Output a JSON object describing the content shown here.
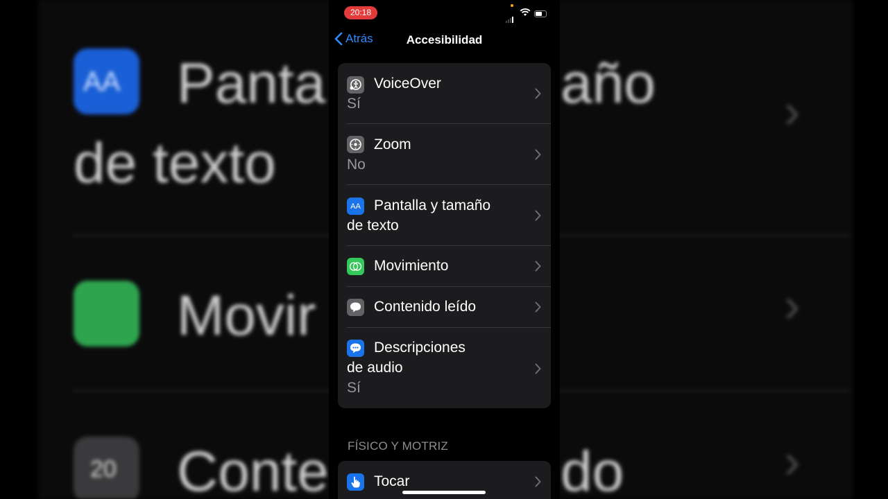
{
  "background": {
    "text1": "Panta",
    "text1b": "año",
    "text2": "de texto",
    "text3": "Movir",
    "text4": "Conte",
    "text4b": "do",
    "icon1_text": "AA",
    "icon3_text": "20"
  },
  "status_bar": {
    "time": "20:18"
  },
  "nav": {
    "back_label": "Atrás",
    "title": "Accesibilidad"
  },
  "vision": {
    "items": [
      {
        "label": "VoiceOver",
        "value": "Sí",
        "icon": "voiceover-icon"
      },
      {
        "label": "Zoom",
        "value": "No",
        "icon": "zoom-icon"
      },
      {
        "label_line1": "Pantalla y tamaño",
        "label_line2": "de texto",
        "icon": "display-text-size-icon",
        "icon_text": "AA"
      },
      {
        "label": "Movimiento",
        "icon": "motion-icon"
      },
      {
        "label": "Contenido leído",
        "icon": "spoken-content-icon"
      },
      {
        "label_line1": "Descripciones",
        "label_line2": "de audio",
        "value": "Sí",
        "icon": "audio-descriptions-icon"
      }
    ]
  },
  "physical": {
    "section_title": "FÍSICO Y MOTRIZ",
    "items": [
      {
        "label": "Tocar",
        "icon": "touch-icon"
      }
    ]
  },
  "colors": {
    "accent": "#2e8bff",
    "group_bg": "#1c1c1e",
    "secondary_text": "#98989d",
    "display_icon": "#1a73e8",
    "motion_icon": "#34c759",
    "gray_icon": "#636366"
  }
}
